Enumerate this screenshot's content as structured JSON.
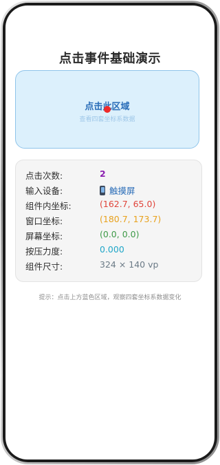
{
  "page": {
    "title": "点击事件基础演示",
    "hint": "提示：点击上方蓝色区域，观察四套坐标系数据变化"
  },
  "click_area": {
    "title": "点击此区域",
    "subtitle": "查看四套坐标系数据"
  },
  "info": {
    "rows": [
      {
        "label": "点击次数:",
        "value": "2"
      },
      {
        "label": "输入设备:",
        "value": "触摸屏",
        "icon": "phone-icon"
      },
      {
        "label": "组件内坐标:",
        "value": "(162.7, 65.0)"
      },
      {
        "label": "窗口坐标:",
        "value": "(180.7, 173.7)"
      },
      {
        "label": "屏幕坐标:",
        "value": "(0.0, 0.0)"
      },
      {
        "label": "按压力度:",
        "value": "0.000"
      },
      {
        "label": "组件尺寸:",
        "value": "324 × 140 vp"
      }
    ]
  },
  "colors": {
    "accent_blue": "#2a6db8",
    "tap_dot": "#ee2a2a",
    "count": "#8b1fb0",
    "local_coord": "#e0443a",
    "window_coord": "#e8a11c",
    "screen_coord": "#3e9a48",
    "pressure": "#1fa6c8",
    "size": "#6b7a86"
  }
}
